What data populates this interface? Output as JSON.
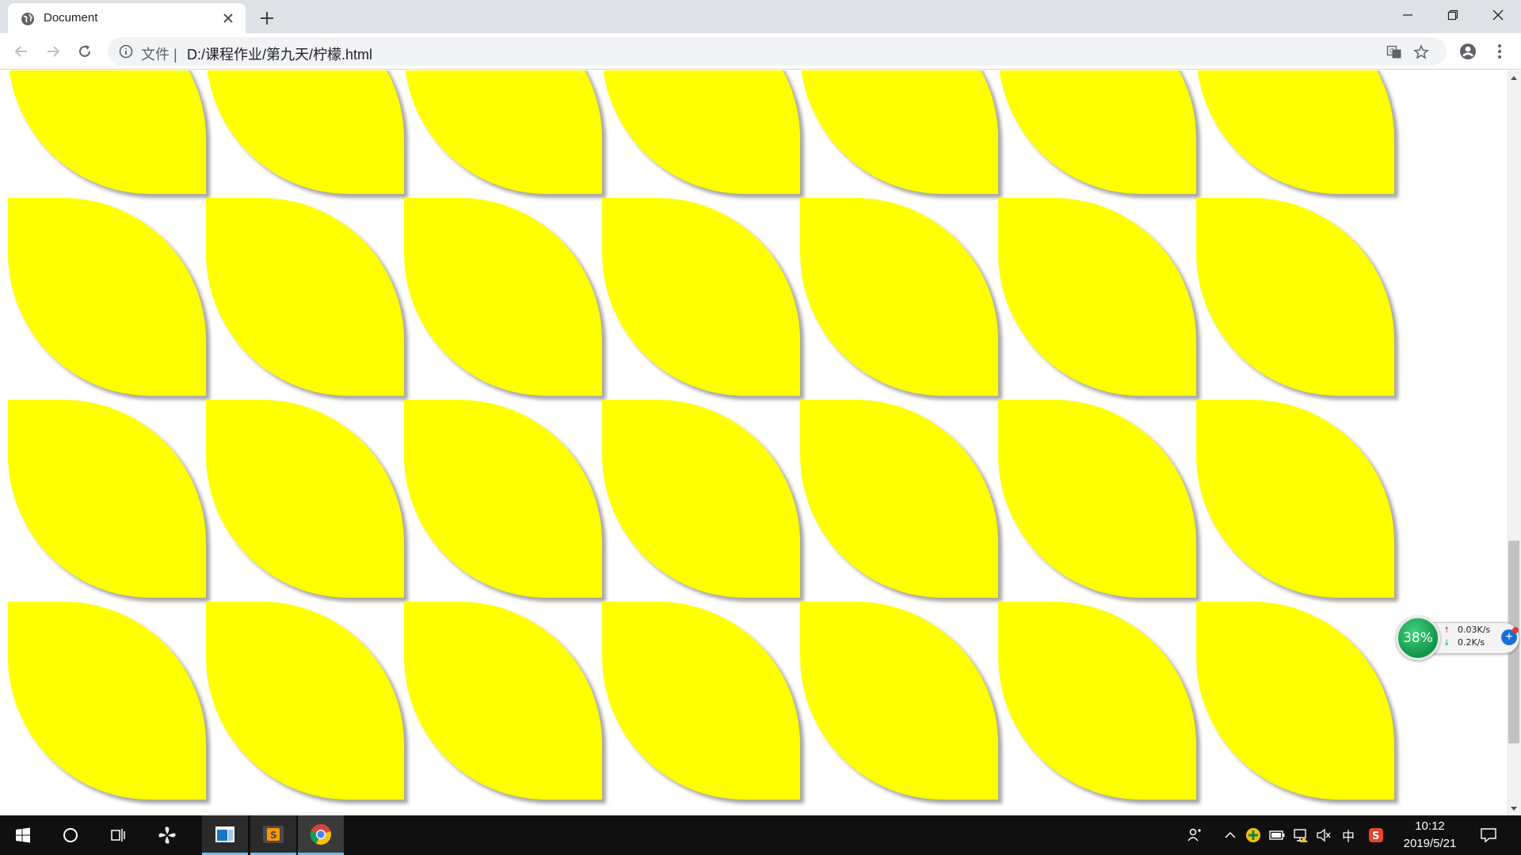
{
  "browser": {
    "tab_title": "Document",
    "omnibox": {
      "scheme_label": "文件",
      "url": "D:/课程作业/第九天/柠檬.html"
    },
    "icons": {
      "favicon": "globe-icon",
      "tab_close": "close-icon",
      "new_tab": "plus-icon",
      "back": "back-arrow-icon",
      "forward": "forward-arrow-icon",
      "reload": "reload-icon",
      "info": "info-icon",
      "translate": "translate-icon",
      "bookmark": "star-icon",
      "profile": "account-icon",
      "menu": "more-vertical-icon",
      "minimize": "minimize-icon",
      "restore": "restore-icon",
      "close": "window-close-icon"
    }
  },
  "page": {
    "leaf_color": "#ffff00",
    "leaf_rows": 4,
    "leaf_columns": 7
  },
  "network_monitor": {
    "percent": "38%",
    "upload": "0.03K/s",
    "download": "0.2K/s"
  },
  "taskbar": {
    "apps": [
      "windows-start-icon",
      "cortana-search-icon",
      "task-view-icon",
      "pinwheel-app-icon",
      "file-window-icon",
      "sublime-text-icon",
      "chrome-icon"
    ],
    "tray": {
      "ime_label": "中",
      "time": "10:12",
      "date": "2019/5/21"
    }
  }
}
